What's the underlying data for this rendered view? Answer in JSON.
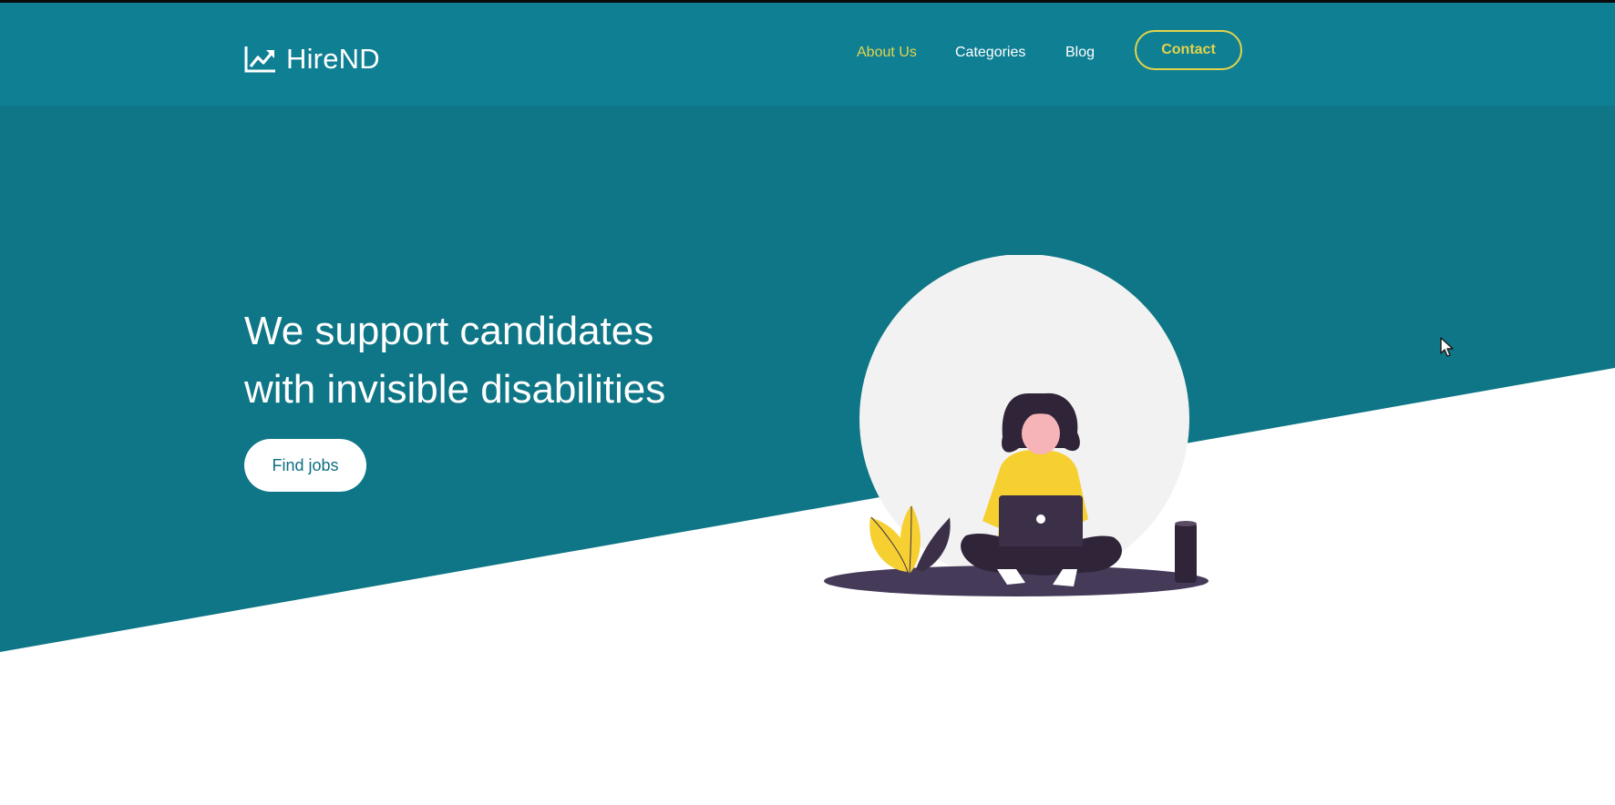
{
  "header": {
    "brand": "HireND",
    "logo_icon": "trending-up-chart-icon",
    "nav": [
      {
        "label": "About Us",
        "active": true
      },
      {
        "label": "Categories",
        "active": false
      },
      {
        "label": "Blog",
        "active": false
      }
    ],
    "contact_label": "Contact"
  },
  "hero": {
    "headline_line1": "We support candidates",
    "headline_line2": "with invisible disabilities",
    "cta_label": "Find jobs",
    "illustration": "woman-with-laptop-illustration"
  },
  "colors": {
    "header_bg": "#0f7f94",
    "hero_bg": "#0e7686",
    "accent": "#e4d34a",
    "white": "#ffffff"
  }
}
